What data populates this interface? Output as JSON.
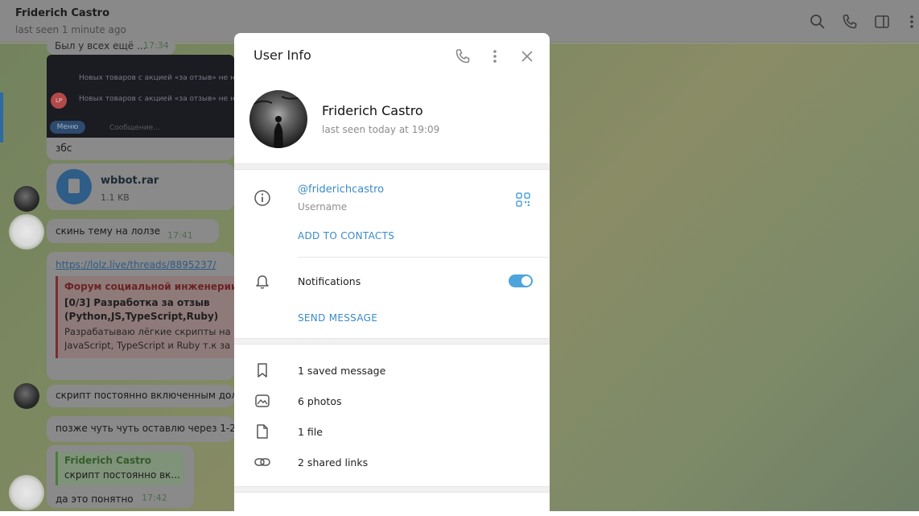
{
  "chat_header": {
    "name": "Friderich Castro",
    "status": "last seen 1 minute ago"
  },
  "chat": {
    "msg_cutoff_text": "Был у всех ещё ...",
    "msg_cutoff_time": "17:34",
    "bot_rows": [
      "Новых товаров с акцией «за отзыв» не на",
      "Новых товаров с акцией «за отзыв» не на"
    ],
    "bot_avatar_initials": "LP",
    "bot_menu_label": "Меню",
    "bot_input_placeholder": "Сообщение...",
    "msg_zbs": "збс",
    "file_name": "wbbot.rar",
    "file_size": "1.1 KB",
    "msg_lolz_text": "скинь тему на лолзе",
    "msg_lolz_time": "17:41",
    "link_url": "https://lolz.live/threads/8895237/",
    "preview_site": "Форум социальной инженерии –",
    "preview_title": "[0/3] Разработка за отзыв (Python,JS,TypeScript,Ruby)",
    "preview_desc": "Разрабатываю лёгкие скрипты на JavaScript, TypeScript и Ruby т.к за",
    "msg_script": "скрипт постоянно включенным дол",
    "msg_later": "позже чуть чуть оставлю через 1-2",
    "reply_author": "Friderich Castro",
    "reply_text": "скрипт постоянно вк...",
    "msg_clear": "да это понятно",
    "msg_clear_time": "17:42"
  },
  "modal": {
    "title": "User Info",
    "user_name": "Friderich Castro",
    "user_status": "last seen today at 19:09",
    "username": "@friderichcastro",
    "username_label": "Username",
    "add_contacts": "ADD TO CONTACTS",
    "notifications_label": "Notifications",
    "notifications_on": true,
    "send_message": "SEND MESSAGE",
    "media": [
      {
        "icon": "bookmark-icon",
        "label": "1 saved message"
      },
      {
        "icon": "photo-icon",
        "label": "6 photos"
      },
      {
        "icon": "file-icon",
        "label": "1 file"
      },
      {
        "icon": "link-icon",
        "label": "2 shared links"
      }
    ]
  },
  "colors": {
    "accent": "#3a8bc8",
    "toggle_on": "#4ea4dc"
  }
}
